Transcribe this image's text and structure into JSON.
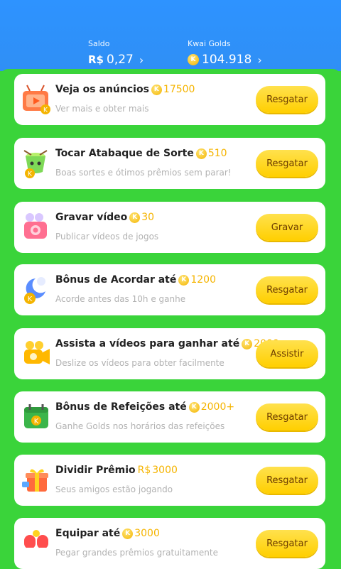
{
  "header": {
    "saldo": {
      "label": "Saldo",
      "currency": "R$",
      "value": "0,27",
      "chevron": "›"
    },
    "golds": {
      "label": "Kwai Golds",
      "value": "104.918",
      "chevron": "›",
      "coin_glyph": "K"
    }
  },
  "colors": {
    "header": "#2f8ff5",
    "panel": "#3ad43a",
    "coin": "#f4b400",
    "button": "#ffd21f"
  },
  "tasks": [
    {
      "title": "Veja os anúncios",
      "reward": "17500",
      "reward_prefix": "",
      "desc": "Ver mais e obter mais",
      "button": "Resgatar",
      "icon": "tv-icon"
    },
    {
      "title": "Tocar Atabaque de Sorte",
      "reward": "510",
      "reward_prefix": "",
      "desc": "Boas sortes e ótimos prêmios sem parar!",
      "button": "Resgatar",
      "icon": "drum-icon"
    },
    {
      "title": "Gravar vídeo",
      "reward": "30",
      "reward_prefix": "",
      "desc": "Publicar vídeos de jogos",
      "button": "Gravar",
      "icon": "camera-icon"
    },
    {
      "title": "Bônus de Acordar até",
      "reward": "1200",
      "reward_prefix": "",
      "desc": "Acorde antes das 10h e ganhe",
      "button": "Resgatar",
      "icon": "moon-icon"
    },
    {
      "title": "Assista a vídeos para ganhar até",
      "reward": "2000",
      "reward_prefix": "",
      "desc": "Deslize os vídeos para obter facilmente",
      "button": "Assistir",
      "icon": "video-camera-icon"
    },
    {
      "title": "Bônus de Refeições até",
      "reward": "2000+",
      "reward_prefix": "",
      "desc": "Ganhe Golds nos horários das refeições",
      "button": "Resgatar",
      "icon": "calendar-icon"
    },
    {
      "title": "Dividir Prêmio",
      "reward": "3000",
      "reward_prefix": "R$",
      "desc": "Seus amigos estão jogando",
      "button": "Resgatar",
      "icon": "gift-icon"
    },
    {
      "title": "Equipar até",
      "reward": "3000",
      "reward_prefix": "",
      "desc": "Pegar grandes prêmios gratuitamente",
      "button": "Resgatar",
      "icon": "boxing-gloves-icon"
    }
  ]
}
